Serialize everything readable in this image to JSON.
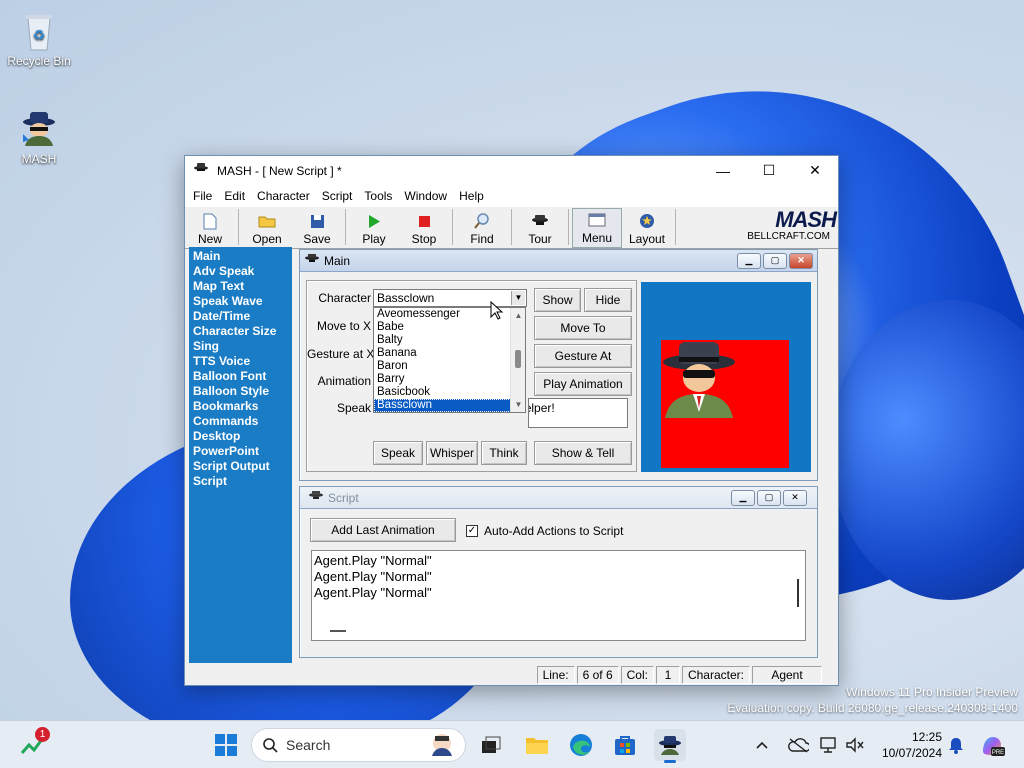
{
  "desktop": {
    "icons": [
      {
        "label": "Recycle Bin",
        "icon": "recycle-bin-icon"
      },
      {
        "label": "MASH",
        "icon": "mash-agent-icon"
      }
    ],
    "watermark_line1": "Windows 11 Pro Insider Preview",
    "watermark_line2": "Evaluation copy. Build 26080.ge_release.240308-1400"
  },
  "window": {
    "title": "MASH - [ New Script ] *",
    "menu": [
      "File",
      "Edit",
      "Character",
      "Script",
      "Tools",
      "Window",
      "Help"
    ],
    "toolbar": {
      "new": "New",
      "open": "Open",
      "save": "Save",
      "play": "Play",
      "stop": "Stop",
      "find": "Find",
      "tour": "Tour",
      "menu": "Menu",
      "layout": "Layout"
    },
    "logo_text": "MASH",
    "logo_sub": "BELLCRAFT.COM",
    "sidebar": [
      "Main",
      "Adv Speak",
      "Map Text",
      "Speak Wave",
      "Date/Time",
      "Character Size",
      "Sing",
      "TTS Voice",
      "Balloon Font",
      "Balloon Style",
      "Bookmarks",
      "Commands",
      "Desktop",
      "PowerPoint",
      "Script Output",
      "Script"
    ]
  },
  "main_panel": {
    "title": "Main",
    "labels": {
      "character": "Character",
      "move_to": "Move to X",
      "gesture_at": "Gesture at X",
      "animation": "Animation",
      "speak": "Speak"
    },
    "character_value": "Bassclown",
    "dropdown_items": [
      "Aveomessenger",
      "Babe",
      "Balty",
      "Banana",
      "Baron",
      "Barry",
      "Basicbook",
      "Bassclown"
    ],
    "dropdown_selected_index": 7,
    "speak_text": "Scripting Helper!",
    "buttons": {
      "show": "Show",
      "hide": "Hide",
      "move_to": "Move To",
      "gesture_at": "Gesture At",
      "play_animation": "Play Animation",
      "speak": "Speak",
      "whisper": "Whisper",
      "think": "Think",
      "show_tell": "Show & Tell"
    }
  },
  "script_panel": {
    "title": "Script",
    "add_last": "Add Last Animation",
    "auto_add": "Auto-Add Actions to Script",
    "auto_add_checked": true,
    "lines": [
      "Agent.Play \"Normal\"",
      "Agent.Play \"Normal\"",
      "Agent.Play \"Normal\""
    ]
  },
  "status": {
    "line_label": "Line:",
    "line_value": "6 of 6",
    "col_label": "Col:",
    "col_value": "1",
    "char_label": "Character:",
    "char_value": "Agent"
  },
  "taskbar": {
    "search_placeholder": "Search",
    "notification_count": "1",
    "time": "12:25",
    "date": "10/07/2024"
  }
}
